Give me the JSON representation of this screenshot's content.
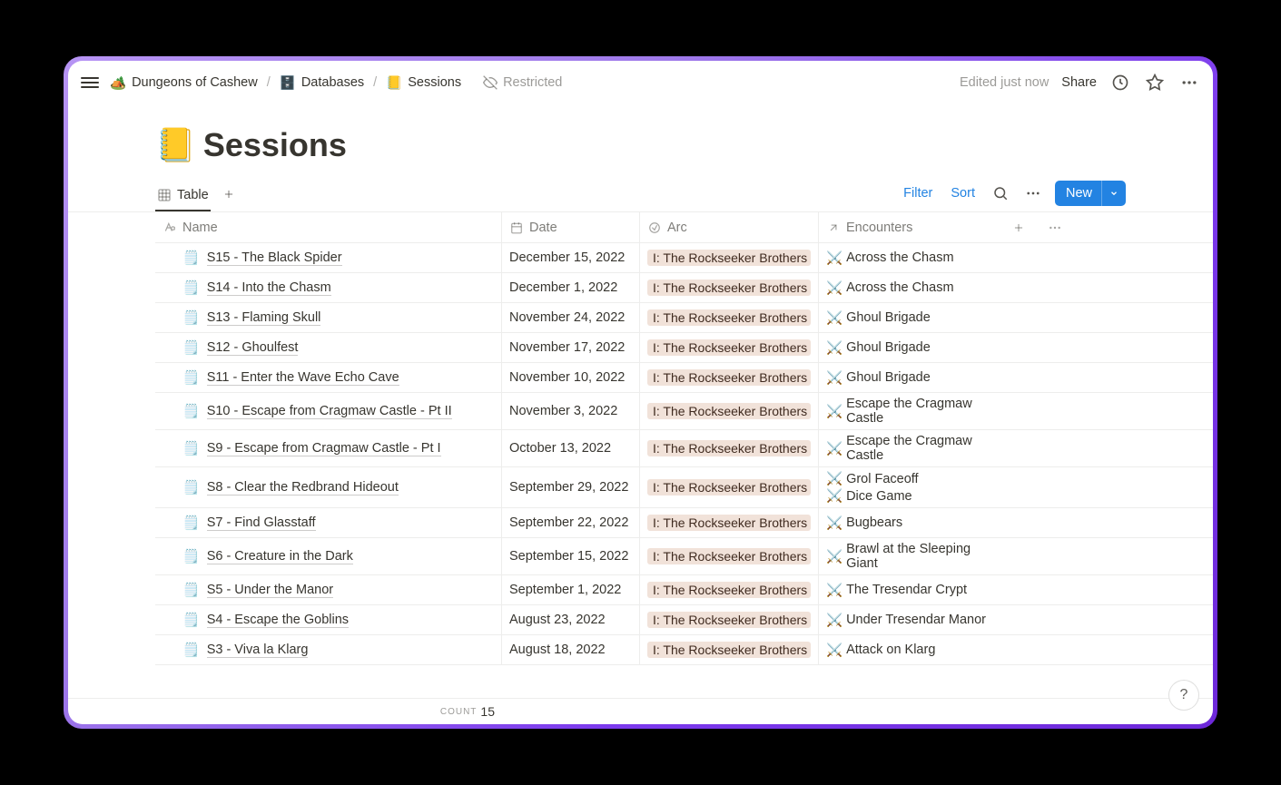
{
  "breadcrumbs": [
    {
      "icon": "🏕️",
      "label": "Dungeons of Cashew"
    },
    {
      "icon": "🗄️",
      "label": "Databases"
    },
    {
      "icon": "📒",
      "label": "Sessions"
    }
  ],
  "restricted_label": "Restricted",
  "edited_label": "Edited just now",
  "share_label": "Share",
  "page": {
    "emoji": "📒",
    "title": "Sessions"
  },
  "view": {
    "tab_label": "Table",
    "filter_label": "Filter",
    "sort_label": "Sort",
    "new_label": "New"
  },
  "columns": {
    "name": "Name",
    "date": "Date",
    "arc": "Arc",
    "encounters": "Encounters"
  },
  "rows": [
    {
      "icon": "🗒️",
      "name": "S15 - The Black Spider",
      "date": "December 15, 2022",
      "arc": "I: The Rockseeker Brothers",
      "encounters": [
        "Across the Chasm"
      ]
    },
    {
      "icon": "🗒️",
      "name": "S14 - Into the Chasm",
      "date": "December 1, 2022",
      "arc": "I: The Rockseeker Brothers",
      "encounters": [
        "Across the Chasm"
      ]
    },
    {
      "icon": "🗒️",
      "name": "S13 - Flaming Skull",
      "date": "November 24, 2022",
      "arc": "I: The Rockseeker Brothers",
      "encounters": [
        "Ghoul Brigade"
      ]
    },
    {
      "icon": "🗒️",
      "name": "S12 - Ghoulfest",
      "date": "November 17, 2022",
      "arc": "I: The Rockseeker Brothers",
      "encounters": [
        "Ghoul Brigade"
      ]
    },
    {
      "icon": "🗒️",
      "name": "S11 - Enter the Wave Echo Cave",
      "date": "November 10, 2022",
      "arc": "I: The Rockseeker Brothers",
      "encounters": [
        "Ghoul Brigade"
      ]
    },
    {
      "icon": "🗒️",
      "name": "S10 - Escape from Cragmaw Castle - Pt II",
      "date": "November 3, 2022",
      "arc": "I: The Rockseeker Brothers",
      "encounters": [
        "Escape the Cragmaw Castle"
      ]
    },
    {
      "icon": "🗒️",
      "name": "S9 - Escape from Cragmaw Castle - Pt I",
      "date": "October 13, 2022",
      "arc": "I: The Rockseeker Brothers",
      "encounters": [
        "Escape the Cragmaw Castle"
      ]
    },
    {
      "icon": "🗒️",
      "name": "S8 - Clear the Redbrand Hideout",
      "date": "September 29, 2022",
      "arc": "I: The Rockseeker Brothers",
      "encounters": [
        "Grol Faceoff",
        "Dice Game"
      ]
    },
    {
      "icon": "🗒️",
      "name": "S7 - Find Glasstaff",
      "date": "September 22, 2022",
      "arc": "I: The Rockseeker Brothers",
      "encounters": [
        "Bugbears"
      ]
    },
    {
      "icon": "🗒️",
      "name": "S6 - Creature in the Dark",
      "date": "September 15, 2022",
      "arc": "I: The Rockseeker Brothers",
      "encounters": [
        "Brawl at the Sleeping Giant"
      ]
    },
    {
      "icon": "🗒️",
      "name": "S5 - Under the Manor",
      "date": "September 1, 2022",
      "arc": "I: The Rockseeker Brothers",
      "encounters": [
        "The Tresendar Crypt"
      ]
    },
    {
      "icon": "🗒️",
      "name": "S4 - Escape the Goblins",
      "date": "August 23, 2022",
      "arc": "I: The Rockseeker Brothers",
      "encounters": [
        "Under Tresendar Manor"
      ]
    },
    {
      "icon": "🗒️",
      "name": "S3 - Viva la Klarg",
      "date": "August 18, 2022",
      "arc": "I: The Rockseeker Brothers",
      "encounters": [
        "Attack on Klarg"
      ]
    }
  ],
  "count": {
    "label": "COUNT",
    "value": "15"
  },
  "help_label": "?",
  "encounter_icon": "⚔️"
}
